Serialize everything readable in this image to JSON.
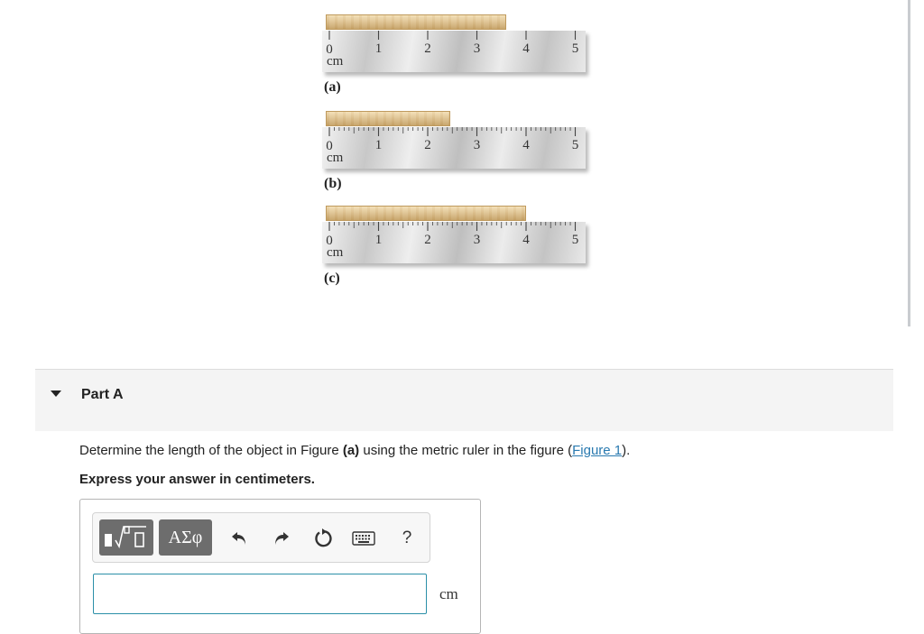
{
  "figure": {
    "unit_label": "cm",
    "ruler_numbers": [
      "0",
      "1",
      "2",
      "3",
      "4",
      "5"
    ],
    "panels": [
      {
        "label": "(a)",
        "object_length_cm": 3.6,
        "minor_divisions_per_cm": 1
      },
      {
        "label": "(b)",
        "object_length_cm": 2.45,
        "minor_divisions_per_cm": 10
      },
      {
        "label": "(c)",
        "object_length_cm": 4.0,
        "minor_divisions_per_cm": 10
      }
    ]
  },
  "part": {
    "title": "Part A",
    "question_before": "Determine the length of the object in Figure ",
    "question_bold": "(a)",
    "question_middle": " using the metric ruler in the figure (",
    "question_link": "Figure 1",
    "question_after": ").",
    "instruction": "Express your answer in centimeters.",
    "toolbar": {
      "symbols_label": "ΑΣφ",
      "help_label": "?",
      "icons": [
        "templates-icon",
        "undo-icon",
        "redo-icon",
        "reset-icon",
        "keyboard-icon"
      ]
    },
    "answer_value": "",
    "answer_unit": "cm"
  },
  "colors": {
    "link": "#2a7ab0",
    "input_border": "#2b8fa8",
    "toolbar_button": "#6d6d6d"
  }
}
